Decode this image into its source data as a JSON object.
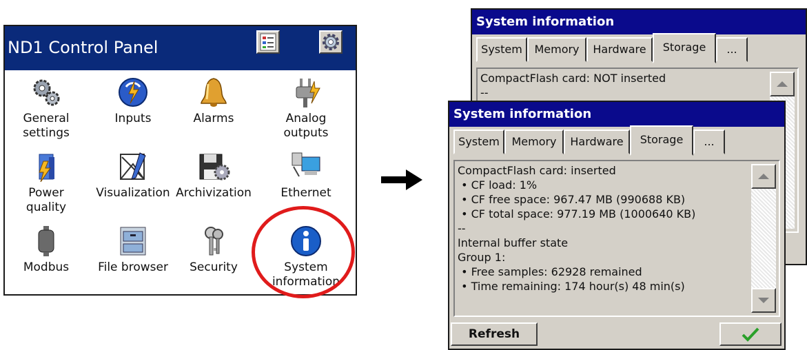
{
  "control_panel": {
    "title": "ND1 Control Panel",
    "items": [
      {
        "label1": "General",
        "label2": "settings",
        "icon": "gears-icon"
      },
      {
        "label1": "Inputs",
        "label2": "",
        "icon": "inputs-icon"
      },
      {
        "label1": "Alarms",
        "label2": "",
        "icon": "bell-icon"
      },
      {
        "label1": "Analog",
        "label2": "outputs",
        "icon": "plug-icon"
      },
      {
        "label1": "Power",
        "label2": "quality",
        "icon": "power-quality-icon"
      },
      {
        "label1": "Visualization",
        "label2": "",
        "icon": "visualization-icon"
      },
      {
        "label1": "Archivization",
        "label2": "",
        "icon": "floppy-gear-icon"
      },
      {
        "label1": "Ethernet",
        "label2": "",
        "icon": "network-icon"
      },
      {
        "label1": "Modbus",
        "label2": "",
        "icon": "modbus-icon"
      },
      {
        "label1": "File browser",
        "label2": "",
        "icon": "file-cabinet-icon"
      },
      {
        "label1": "Security",
        "label2": "",
        "icon": "keys-icon"
      },
      {
        "label1": "System",
        "label2": "information",
        "icon": "info-icon"
      }
    ]
  },
  "sysinfo_back": {
    "title": "System information",
    "tabs": [
      "System",
      "Memory",
      "Hardware",
      "Storage",
      "..."
    ],
    "active_tab": "Storage",
    "lines": [
      "CompactFlash card: NOT inserted",
      "--"
    ]
  },
  "sysinfo_front": {
    "title": "System information",
    "tabs": [
      "System",
      "Memory",
      "Hardware",
      "Storage",
      "..."
    ],
    "active_tab": "Storage",
    "lines": [
      "CompactFlash card: inserted",
      " • CF load: 1%",
      " • CF free space: 967.47 MB (990688 KB)",
      " • CF total space: 977.19 MB (1000640 KB)",
      "--",
      "Internal buffer state",
      "Group 1:",
      " • Free samples: 62928 remained",
      " • Time remaining: 174 hour(s) 48 min(s)"
    ],
    "refresh_label": "Refresh"
  },
  "colors": {
    "title_bar": "#0a2a7a",
    "window_title": "#0a0a8c",
    "highlight_ring": "#e01b1b",
    "face": "#d4d0c8"
  }
}
